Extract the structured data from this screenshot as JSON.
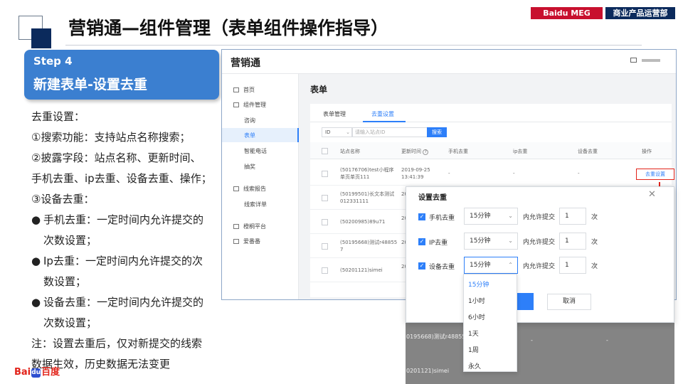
{
  "header": {
    "title": "营销通—组件管理（表单组件操作指导）",
    "tag_meg": "Baidu MEG",
    "tag_dept": "商业产品运营部"
  },
  "step": {
    "number": "Step 4",
    "name": "新建表单-设置去重"
  },
  "description": {
    "lines": [
      "去重设置：",
      "①搜索功能：支持站点名称搜索；",
      "②披露字段：站点名称、更新时间、",
      "手机去重、ip去重、设备去重、操作；",
      "③设备去重："
    ],
    "bullets": [
      {
        "line1": "手机去重：一定时间内允许提交的",
        "line2": "次数设置；"
      },
      {
        "line1": "Ip去重：一定时间内允许提交的次",
        "line2": "数设置；"
      },
      {
        "line1": "设备去重：一定时间内允许提交的",
        "line2": "次数设置；"
      }
    ],
    "note_line1": "注：设置去重后，仅对新提交的线索",
    "note_line2": "数据生效，历史数据无法变更"
  },
  "app": {
    "logo": "营销通",
    "sidebar": {
      "home": "首页",
      "component_mgmt": "组件管理",
      "consult": "咨询",
      "form": "表单",
      "smart_phone": "智能电话",
      "lottery": "抽奖",
      "lead_report": "线索报告",
      "lead_detail": "线索详单",
      "jimu": "橙桐平台",
      "aifanfan": "爱番番"
    },
    "main_title": "表单",
    "tabs": {
      "form_mgmt": "表单管理",
      "dedup": "去重设置"
    },
    "filter": {
      "select": "ID",
      "placeholder": "请输入站点ID",
      "search": "搜索"
    },
    "columns": [
      "站点名称",
      "更新时间",
      "手机去重",
      "ip去重",
      "设备去重",
      "操作"
    ],
    "rows": [
      {
        "name_l1": "(50176706)test小程序",
        "name_l2": "单页单页111",
        "time_l1": "2019-09-25",
        "time_l2": "13:41:39",
        "phone": "-",
        "ip": "-",
        "device": "-"
      },
      {
        "name_l1": "(50199501)长文本测试",
        "name_l2": "012331111",
        "time_l1": "20",
        "time_l2": "",
        "phone": "",
        "ip": "",
        "device": ""
      },
      {
        "name_l1": "(50200985)89u71",
        "name_l2": "",
        "time_l1": "20",
        "time_l2": "",
        "phone": "",
        "ip": "",
        "device": ""
      },
      {
        "name_l1": "(50195668)测试r48855",
        "name_l2": "7",
        "time_l1": "20",
        "time_l2": "",
        "phone": "",
        "ip": "",
        "device": ""
      },
      {
        "name_l1": "(50201121)simei",
        "name_l2": "",
        "time_l1": "20",
        "time_l2": "",
        "phone": "",
        "ip": "",
        "device": ""
      }
    ],
    "op_link": "去重设置"
  },
  "strip": {
    "row1_name": "0195668)测试r48855",
    "row1_dash1": "-",
    "row1_dash2": "-",
    "row2_name": "0201121)simei"
  },
  "dialog": {
    "title": "设置去重",
    "close": "✕",
    "options": [
      {
        "label": "手机去重",
        "interval": "15分钟",
        "allow": "内允许提交",
        "count": "1",
        "unit": "次"
      },
      {
        "label": "IP去重",
        "interval": "15分钟",
        "allow": "内允许提交",
        "count": "1",
        "unit": "次"
      },
      {
        "label": "设备去重",
        "interval": "15分钟",
        "allow": "内允许提交",
        "count": "1",
        "unit": "次"
      }
    ],
    "cancel": "取消",
    "dropdown": [
      "15分钟",
      "1小时",
      "6小时",
      "1天",
      "1周",
      "永久"
    ]
  },
  "footer": {
    "logo_en": "Bai",
    "logo_paw": "du",
    "logo_cn": "百度"
  },
  "colors": {
    "accent": "#2d7ff9",
    "step_card": "#3b7fd0",
    "brand_red": "#e2231a",
    "navy": "#0b2a5c"
  }
}
